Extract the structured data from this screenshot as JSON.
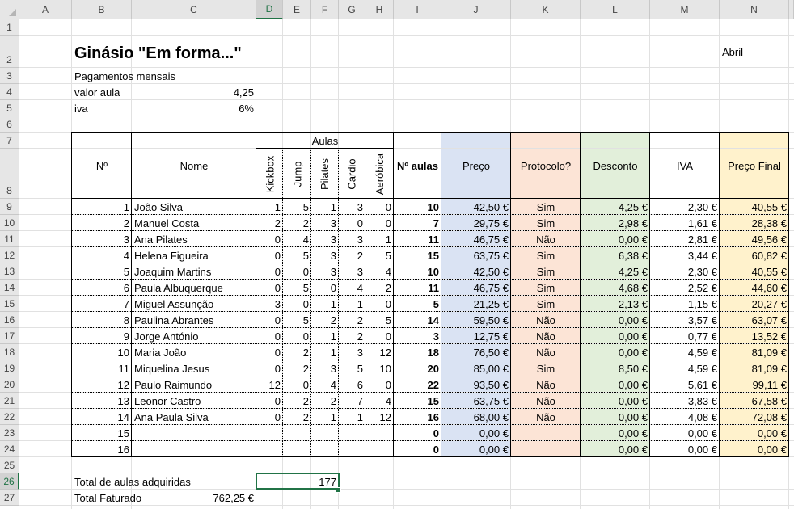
{
  "columns": [
    "A",
    "B",
    "C",
    "D",
    "E",
    "F",
    "G",
    "H",
    "I",
    "J",
    "K",
    "L",
    "M",
    "N"
  ],
  "selected_column": "D",
  "selected_row": 26,
  "header": {
    "title": "Ginásio \"Em forma...\"",
    "month": "Abril",
    "subtitle": "Pagamentos mensais",
    "valor_aula_label": "valor aula",
    "valor_aula": "4,25",
    "iva_label": "iva",
    "iva": "6%"
  },
  "table_headers": {
    "no": "Nº",
    "nome": "Nome",
    "aulas": "Aulas",
    "kickbox": "Kickbox",
    "jump": "Jump",
    "pilates": "Pilates",
    "cardio": "Cardio",
    "aerobica": "Aeróbica",
    "n_aulas": "Nº aulas",
    "preco": "Preço",
    "protocolo": "Protocolo?",
    "desconto": "Desconto",
    "iva": "IVA",
    "preco_final": "Preço Final"
  },
  "rows": [
    {
      "no": "1",
      "nome": "João Silva",
      "k": "1",
      "j": "5",
      "p": "1",
      "c": "3",
      "a": "0",
      "n": "10",
      "preco": "42,50 €",
      "prot": "Sim",
      "desc": "4,25 €",
      "iva": "2,30 €",
      "final": "40,55 €"
    },
    {
      "no": "2",
      "nome": "Manuel Costa",
      "k": "2",
      "j": "2",
      "p": "3",
      "c": "0",
      "a": "0",
      "n": "7",
      "preco": "29,75 €",
      "prot": "Sim",
      "desc": "2,98 €",
      "iva": "1,61 €",
      "final": "28,38 €"
    },
    {
      "no": "3",
      "nome": "Ana Pilates",
      "k": "0",
      "j": "4",
      "p": "3",
      "c": "3",
      "a": "1",
      "n": "11",
      "preco": "46,75 €",
      "prot": "Não",
      "desc": "0,00 €",
      "iva": "2,81 €",
      "final": "49,56 €"
    },
    {
      "no": "4",
      "nome": "Helena Figueira",
      "k": "0",
      "j": "5",
      "p": "3",
      "c": "2",
      "a": "5",
      "n": "15",
      "preco": "63,75 €",
      "prot": "Sim",
      "desc": "6,38 €",
      "iva": "3,44 €",
      "final": "60,82 €"
    },
    {
      "no": "5",
      "nome": "Joaquim Martins",
      "k": "0",
      "j": "0",
      "p": "3",
      "c": "3",
      "a": "4",
      "n": "10",
      "preco": "42,50 €",
      "prot": "Sim",
      "desc": "4,25 €",
      "iva": "2,30 €",
      "final": "40,55 €"
    },
    {
      "no": "6",
      "nome": "Paula Albuquerque",
      "k": "0",
      "j": "5",
      "p": "0",
      "c": "4",
      "a": "2",
      "n": "11",
      "preco": "46,75 €",
      "prot": "Sim",
      "desc": "4,68 €",
      "iva": "2,52 €",
      "final": "44,60 €"
    },
    {
      "no": "7",
      "nome": "Miguel Assunção",
      "k": "3",
      "j": "0",
      "p": "1",
      "c": "1",
      "a": "0",
      "n": "5",
      "preco": "21,25 €",
      "prot": "Sim",
      "desc": "2,13 €",
      "iva": "1,15 €",
      "final": "20,27 €"
    },
    {
      "no": "8",
      "nome": "Paulina Abrantes",
      "k": "0",
      "j": "5",
      "p": "2",
      "c": "2",
      "a": "5",
      "n": "14",
      "preco": "59,50 €",
      "prot": "Não",
      "desc": "0,00 €",
      "iva": "3,57 €",
      "final": "63,07 €"
    },
    {
      "no": "9",
      "nome": "Jorge António",
      "k": "0",
      "j": "0",
      "p": "1",
      "c": "2",
      "a": "0",
      "n": "3",
      "preco": "12,75 €",
      "prot": "Não",
      "desc": "0,00 €",
      "iva": "0,77 €",
      "final": "13,52 €"
    },
    {
      "no": "10",
      "nome": "Maria João",
      "k": "0",
      "j": "2",
      "p": "1",
      "c": "3",
      "a": "12",
      "n": "18",
      "preco": "76,50 €",
      "prot": "Não",
      "desc": "0,00 €",
      "iva": "4,59 €",
      "final": "81,09 €"
    },
    {
      "no": "11",
      "nome": "Miquelina Jesus",
      "k": "0",
      "j": "2",
      "p": "3",
      "c": "5",
      "a": "10",
      "n": "20",
      "preco": "85,00 €",
      "prot": "Sim",
      "desc": "8,50 €",
      "iva": "4,59 €",
      "final": "81,09 €"
    },
    {
      "no": "12",
      "nome": "Paulo Raimundo",
      "k": "12",
      "j": "0",
      "p": "4",
      "c": "6",
      "a": "0",
      "n": "22",
      "preco": "93,50 €",
      "prot": "Não",
      "desc": "0,00 €",
      "iva": "5,61 €",
      "final": "99,11 €"
    },
    {
      "no": "13",
      "nome": "Leonor Castro",
      "k": "0",
      "j": "2",
      "p": "2",
      "c": "7",
      "a": "4",
      "n": "15",
      "preco": "63,75 €",
      "prot": "Não",
      "desc": "0,00 €",
      "iva": "3,83 €",
      "final": "67,58 €"
    },
    {
      "no": "14",
      "nome": "Ana  Paula Silva",
      "k": "0",
      "j": "2",
      "p": "1",
      "c": "1",
      "a": "12",
      "n": "16",
      "preco": "68,00 €",
      "prot": "Não",
      "desc": "0,00 €",
      "iva": "4,08 €",
      "final": "72,08 €"
    },
    {
      "no": "15",
      "nome": "",
      "k": "",
      "j": "",
      "p": "",
      "c": "",
      "a": "",
      "n": "0",
      "preco": "0,00 €",
      "prot": "",
      "desc": "0,00 €",
      "iva": "0,00 €",
      "final": "0,00 €"
    },
    {
      "no": "16",
      "nome": "",
      "k": "",
      "j": "",
      "p": "",
      "c": "",
      "a": "",
      "n": "0",
      "preco": "0,00 €",
      "prot": "",
      "desc": "0,00 €",
      "iva": "0,00 €",
      "final": "0,00 €"
    }
  ],
  "totals": {
    "aulas_label": "Total de aulas adquiridas",
    "aulas_value": "177",
    "faturado_label": "Total Faturado",
    "faturado_value": "762,25 €"
  },
  "colors": {
    "preco_fill": "#dae3f3",
    "protocolo_fill": "#fce4d6",
    "desconto_fill": "#e2efda",
    "final_fill": "#fff2cc",
    "selection": "#217346"
  }
}
